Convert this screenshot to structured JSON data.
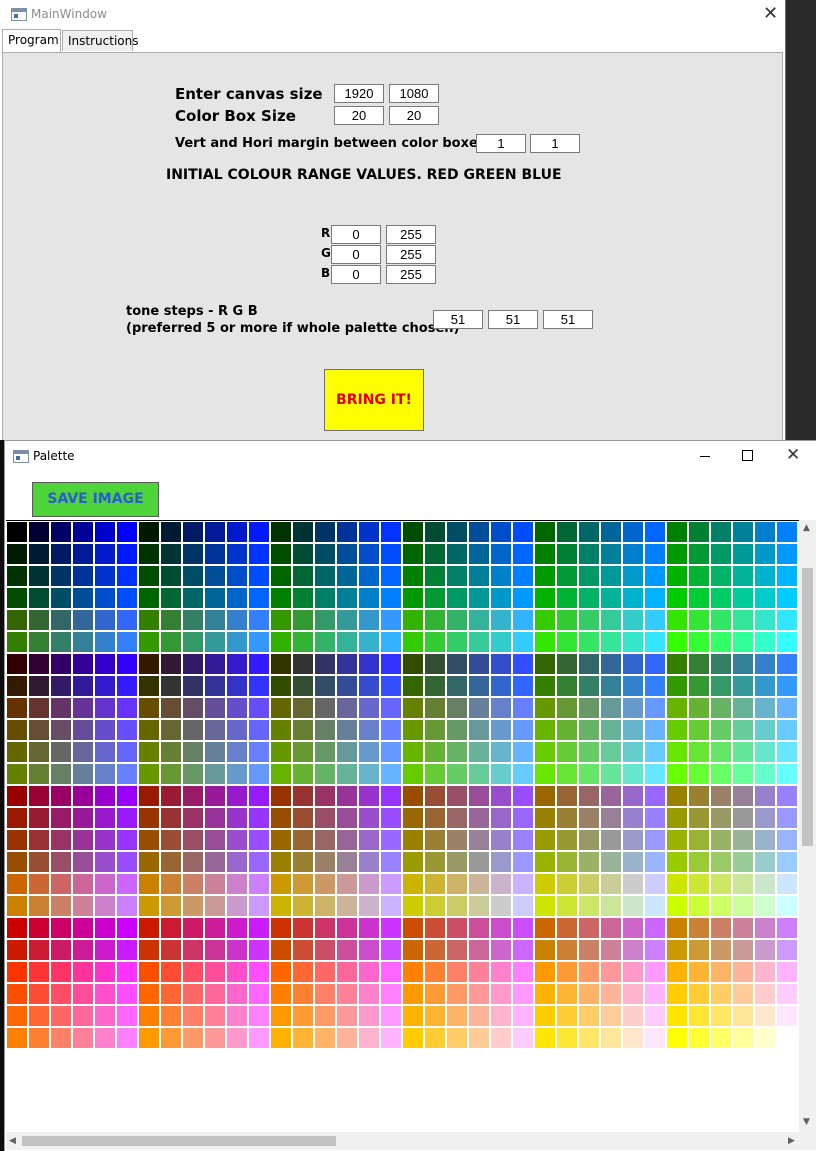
{
  "main_window": {
    "title": "MainWindow",
    "close_glyph": "✕",
    "tabs": [
      {
        "label": "Program",
        "selected": true
      },
      {
        "label": "Instructions",
        "selected": false
      }
    ],
    "program": {
      "canvas_label": "Enter canvas size",
      "canvas_width": "1920",
      "canvas_height": "1080",
      "colorbox_label": "Color Box Size",
      "colorbox_width": "20",
      "colorbox_height": "20",
      "margin_label": "Vert and Hori margin between color boxes",
      "margin_vert": "1",
      "margin_hori": "1",
      "range_heading": "INITIAL COLOUR RANGE VALUES. RED GREEN BLUE",
      "r_label": "R",
      "r_min": "0",
      "r_max": "255",
      "g_label": "G",
      "g_min": "0",
      "g_max": "255",
      "b_label": "B",
      "b_min": "0",
      "b_max": "255",
      "tone_label_1": "tone steps - R G B",
      "tone_label_2": "(preferred 5 or more if whole palette chosen)",
      "tone_r": "51",
      "tone_g": "51",
      "tone_b": "51",
      "bring_button": "BRING IT!"
    }
  },
  "palette_window": {
    "title": "Palette",
    "minimize_glyph": "—",
    "close_glyph": "✕",
    "save_button": "SAVE IMAGE",
    "swatch_grid": {
      "tone_levels": [
        0,
        51,
        102,
        153,
        204,
        255
      ],
      "visible_columns": 36,
      "visible_rows": 24
    },
    "scroll_arrows": {
      "up": "▲",
      "down": "▼",
      "left": "◀",
      "right": "▶"
    }
  },
  "colors": {
    "bring_button_bg": "#ffff00",
    "bring_button_text": "#e0001b",
    "save_button_bg": "#4cd438",
    "save_button_text": "#2a5bd7",
    "panel_bg": "#e5e5e5"
  }
}
